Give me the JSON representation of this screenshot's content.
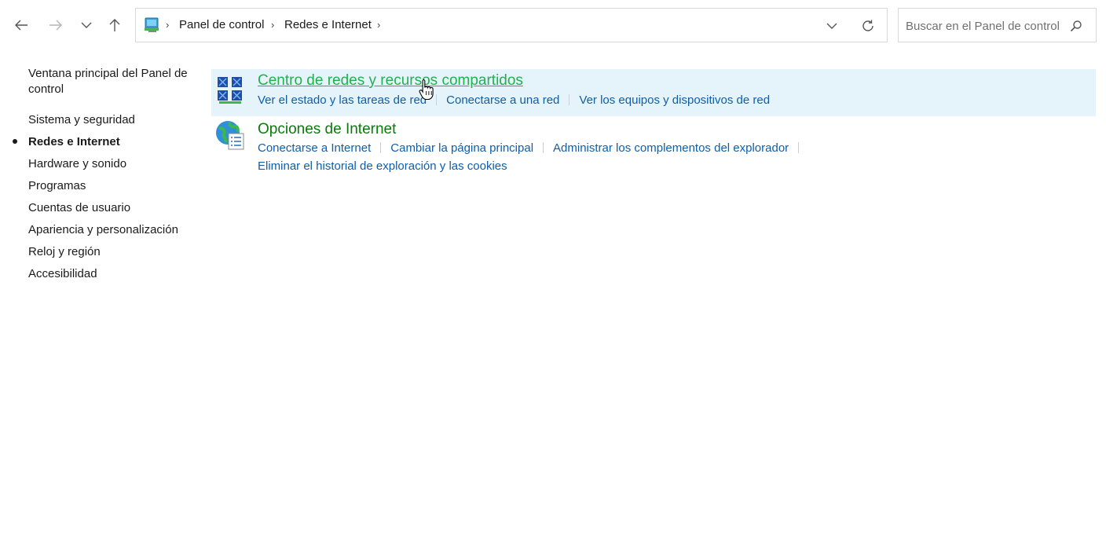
{
  "addressbar": {
    "breadcrumbs": [
      "Panel de control",
      "Redes e Internet"
    ]
  },
  "search": {
    "placeholder": "Buscar en el Panel de control"
  },
  "sidebar": {
    "home_label": "Ventana principal del Panel de control",
    "items": [
      {
        "label": "Sistema y seguridad",
        "active": false
      },
      {
        "label": "Redes e Internet",
        "active": true
      },
      {
        "label": "Hardware y sonido",
        "active": false
      },
      {
        "label": "Programas",
        "active": false
      },
      {
        "label": "Cuentas de usuario",
        "active": false
      },
      {
        "label": "Apariencia y personalización",
        "active": false
      },
      {
        "label": "Reloj y región",
        "active": false
      },
      {
        "label": "Accesibilidad",
        "active": false
      }
    ]
  },
  "main": {
    "categories": [
      {
        "title": "Centro de redes y recursos compartidos",
        "icon": "network-sharing-icon",
        "tasks": [
          "Ver el estado y las tareas de red",
          "Conectarse a una red",
          "Ver los equipos y dispositivos de red"
        ]
      },
      {
        "title": "Opciones de Internet",
        "icon": "internet-options-icon",
        "tasks": [
          "Conectarse a Internet",
          "Cambiar la página principal",
          "Administrar los complementos del explorador",
          "Eliminar el historial de exploración y las cookies"
        ]
      }
    ]
  },
  "colors": {
    "category_title": "#0b7a0b",
    "category_title_hover": "#22b14c",
    "task_link": "#0f5ea8",
    "hover_background": "#e5f3fb"
  }
}
